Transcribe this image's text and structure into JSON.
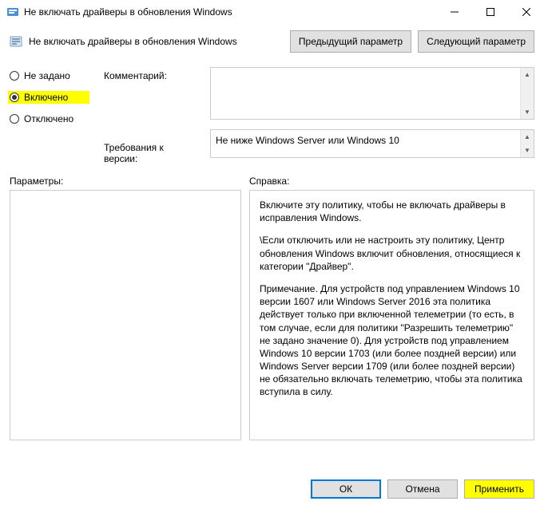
{
  "window": {
    "title": "Не включать драйверы в обновления Windows"
  },
  "header": {
    "policy_title": "Не включать драйверы в обновления Windows",
    "prev_button": "Предыдущий параметр",
    "next_button": "Следующий параметр"
  },
  "radios": {
    "not_configured": "Не задано",
    "enabled": "Включено",
    "disabled": "Отключено"
  },
  "labels": {
    "comment": "Комментарий:",
    "requirements": "Требования к версии:",
    "parameters": "Параметры:",
    "help": "Справка:"
  },
  "fields": {
    "comment_value": "",
    "requirements_value": "Не ниже Windows Server или Windows 10"
  },
  "help": {
    "p1": "Включите эту политику, чтобы не включать драйверы в исправления Windows.",
    "p2": "\\Если отключить или не настроить эту политику, Центр обновления Windows включит обновления, относящиеся к категории \"Драйвер\".",
    "p3": "Примечание. Для устройств под управлением Windows 10 версии 1607 или Windows Server 2016 эта политика действует только при включенной телеметрии (то есть, в том случае, если для политики \"Разрешить телеметрию\" не задано значение 0). Для устройств под управлением Windows 10 версии 1703 (или более поздней версии) или Windows Server версии 1709 (или более поздней версии) не обязательно включать телеметрию, чтобы эта политика вступила в силу."
  },
  "footer": {
    "ok": "ОК",
    "cancel": "Отмена",
    "apply": "Применить"
  }
}
